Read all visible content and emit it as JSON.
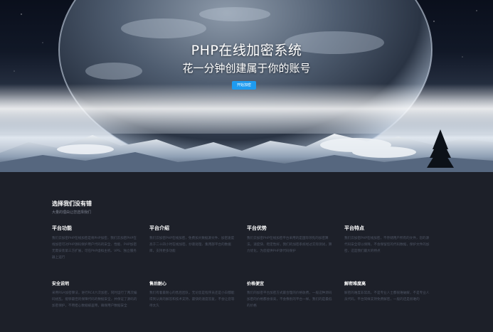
{
  "hero": {
    "title": "PHP在线加密系统",
    "subtitle": "花一分钟创建属于你的账号",
    "button_label": "开始加密"
  },
  "section": {
    "heading": "选择我们没有错",
    "subheading": "大量的理由让您选择我们"
  },
  "features_row1": [
    {
      "title": "平台功能",
      "text": "我们云加密PHP在线加密是将PHP加密，我们云加密PHP在线加密可对PHP源码保护用户代码的安全、性能、PHP加密无需安装第三方扩展，可在PHP虚拟主机、VPS、独立服务器上运行"
    },
    {
      "title": "平台介绍",
      "text": "我们云加密PHP在线加密，免费加大数据源文件、加密速度高于二十四小时在线加密，抄袭处理、集用部平台的数据库，支持更多功能"
    },
    {
      "title": "平台优势",
      "text": "我们云加密PHP在线加密平台采用的是国际领先的加密算法，速度快、稳定性好，我们的加密系统经过实际测试，算力优化，为您提供PHP源代码保护"
    },
    {
      "title": "平台特点",
      "text": "我们云加密PHP在线加密，不存储用户所有的文件，您的源代码安全得以保障，不会保留您的代码数据，保护文件的加密，这是我们最大的特点"
    }
  ],
  "features_row2": [
    {
      "title": "安全说明",
      "text": "采用RSA加密算法，进行RC4六次加密，同时运行了两次编码扰乱，能够最佳的保障代码的数据安全，并保证了源码的加密保护，不用担心数据被盗用，确保用户数据安全"
    },
    {
      "title": "售后耐心",
      "text": "我们有着最耐心的售后团队，无论您是程序员还是小白都能得到认真的解答和技术支持，最快的速度答复，不会让您等待太久"
    },
    {
      "title": "价格便宜",
      "text": "我们的加密平台加密方式最合理的价格收费，一般这种源码加密的价格都会很高，不会像别的平台一样，我们的是最低的价格"
    },
    {
      "title": "解密难度高",
      "text": "解密的难度非常高，不是专业人士都很难破解，不是专业人员代码，平台同样支持免费解密，一般的还是很难的"
    }
  ],
  "colors": {
    "page_bg": "#1d2029",
    "accent": "#1e9bf0",
    "muted_text": "#4f5666"
  }
}
